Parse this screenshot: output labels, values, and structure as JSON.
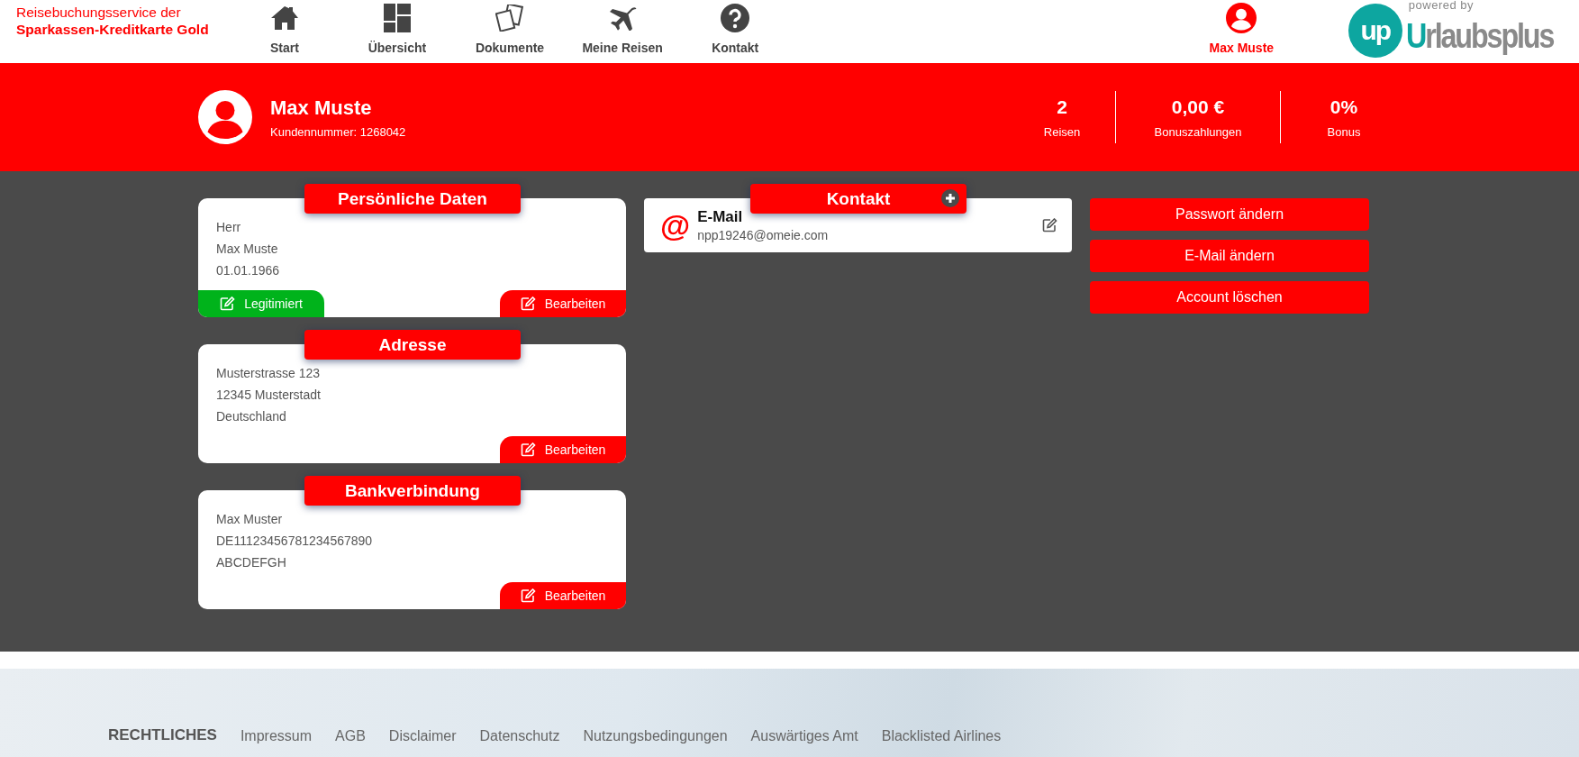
{
  "brand": {
    "line1": "Reisebuchungsservice der",
    "line2": "Sparkassen-Kreditkarte Gold"
  },
  "nav": [
    {
      "label": "Start"
    },
    {
      "label": "Übersicht"
    },
    {
      "label": "Dokumente"
    },
    {
      "label": "Meine Reisen"
    },
    {
      "label": "Kontakt"
    }
  ],
  "user_menu": {
    "label": "Max Muste"
  },
  "logo": {
    "tagline": "powered by",
    "mark": "up",
    "name": "Urlaubsplus"
  },
  "profile": {
    "name": "Max Muste",
    "customer_number": "Kundennummer: 1268042",
    "stats": [
      {
        "value": "2",
        "label": "Reisen"
      },
      {
        "value": "0,00 €",
        "label": "Bonuszahlungen"
      },
      {
        "value": "0%",
        "label": "Bonus"
      }
    ]
  },
  "cards": [
    {
      "title": "Persönliche Daten",
      "lines": [
        "Herr",
        "Max Muste",
        "01.01.1966"
      ],
      "actions": [
        {
          "label": "Legitimiert",
          "kind": "verified"
        },
        {
          "label": "Bearbeiten",
          "kind": "edit"
        }
      ]
    },
    {
      "title": "Adresse",
      "lines": [
        "Musterstrasse 123",
        "12345 Musterstadt",
        "Deutschland"
      ],
      "actions": [
        {
          "label": "Bearbeiten",
          "kind": "edit"
        }
      ]
    },
    {
      "title": "Bankverbindung",
      "lines": [
        "Max Muster",
        "DE11123456781234567890",
        "ABCDEFGH"
      ],
      "actions": [
        {
          "label": "Bearbeiten",
          "kind": "edit"
        }
      ]
    }
  ],
  "contact": {
    "title": "Kontakt",
    "entries": [
      {
        "symbol": "@",
        "label": "E-Mail",
        "value": "npp19246@omeie.com"
      }
    ]
  },
  "account_buttons": [
    "Passwort ändern",
    "E-Mail ändern",
    "Account löschen"
  ],
  "footer": {
    "heading": "RECHTLICHES",
    "links": [
      "Impressum",
      "AGB",
      "Disclaimer",
      "Datenschutz",
      "Nutzungsbedingungen",
      "Auswärtiges Amt",
      "Blacklisted Airlines"
    ]
  }
}
